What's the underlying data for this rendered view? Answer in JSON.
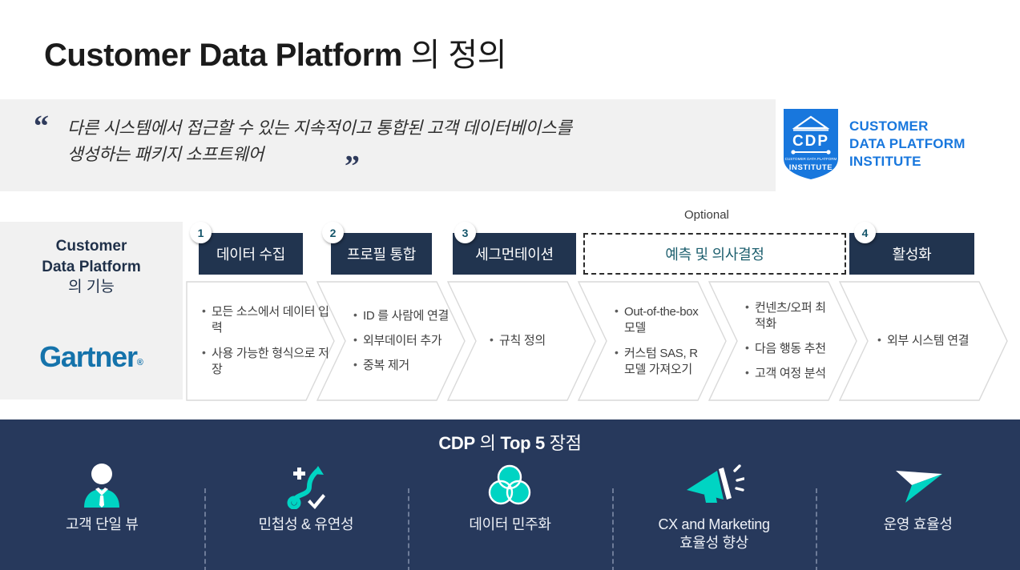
{
  "title": {
    "en": "Customer Data Platform",
    "kr": " 의 정의"
  },
  "quote": {
    "open_mark": "“",
    "close_mark": "”",
    "line1": "다른 시스템에서 접근할 수 있는 지속적이고 통합된 고객 데이터베이스를",
    "line2": "생성하는 패키지 소프트웨어"
  },
  "cdp_institute": {
    "badge_text": "CDP",
    "badge_sub": "CUSTOMER DATA PLATFORM",
    "badge_institute": "INSTITUTE",
    "line1": "CUSTOMER",
    "line2": "DATA PLATFORM",
    "line3": "INSTITUTE",
    "color": "#1877dd"
  },
  "left_panel": {
    "title_en1": "Customer",
    "title_en2": "Data Platform",
    "title_kr": "의 기능",
    "logo": "Gartner",
    "logo_mark": "®",
    "logo_color": "#1573ab"
  },
  "process": {
    "optional_label": "Optional",
    "steps": [
      {
        "num": "1",
        "label": "데이터 수집",
        "optional": false,
        "items": [
          "모든 소스에서 데이터 입력",
          "사용 가능한 형식으로 저장"
        ]
      },
      {
        "num": "2",
        "label": "프로필 통합",
        "optional": false,
        "items": [
          "ID 를 사람에 연결",
          "외부데이터 추가",
          "중복 제거"
        ]
      },
      {
        "num": "3",
        "label": "세그먼테이션",
        "optional": false,
        "items": [
          "규칙 정의"
        ]
      },
      {
        "num": "",
        "label": "예측 및 의사결정",
        "optional": true,
        "items": [
          "Out-of-the-box 모델",
          "커스텀 SAS, R 모델 가져오기"
        ]
      },
      {
        "num": "",
        "label": "",
        "optional": false,
        "items": [
          "컨넨츠/오퍼 최적화",
          "다음 행동 추천",
          "고객 여정 분석"
        ]
      },
      {
        "num": "4",
        "label": "활성화",
        "optional": false,
        "items": [
          "외부 시스템 연결"
        ]
      }
    ]
  },
  "banner": {
    "title_en": "CDP",
    "title_kr1": " 의 ",
    "title_top5": "Top 5",
    "title_kr2": " 장점",
    "accent_color": "#00d4c3",
    "bg_color": "#27395c",
    "benefits": [
      {
        "icon": "person-tie-icon",
        "label": "고객 단일 뷰"
      },
      {
        "icon": "flexible-path-icon",
        "label": "민첩성 & 유연성"
      },
      {
        "icon": "venn-diagram-icon",
        "label": "데이터 민주화"
      },
      {
        "icon": "megaphone-icon",
        "label_line1": "CX and Marketing",
        "label_line2": "효율성 향상"
      },
      {
        "icon": "paper-plane-icon",
        "label": "운영 효율성"
      }
    ]
  }
}
